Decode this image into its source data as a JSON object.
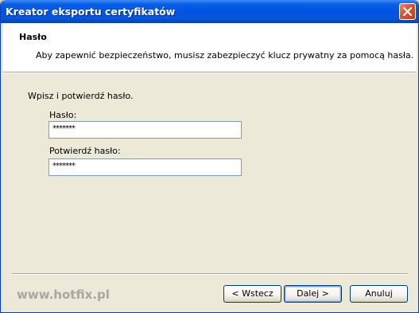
{
  "window": {
    "title": "Kreator eksportu certyfikatów"
  },
  "header": {
    "title": "Hasło",
    "description": "Aby zapewnić bezpieczeństwo, musisz zabezpieczyć klucz prywatny za pomocą hasła."
  },
  "form": {
    "instruction": "Wpisz i potwierdź hasło.",
    "password_label": "Hasło:",
    "password_value": "*******",
    "confirm_label": "Potwierdź hasło:",
    "confirm_value": "*******"
  },
  "footer": {
    "watermark": "www.hotfix.pl",
    "back_label": "< Wstecz",
    "next_label": "Dalej >",
    "cancel_label": "Anuluj"
  },
  "icons": {
    "close": "close-icon"
  },
  "colors": {
    "titlebar": "#0054e3",
    "window_bg": "#ece9d8",
    "close_button": "#d9532f"
  }
}
